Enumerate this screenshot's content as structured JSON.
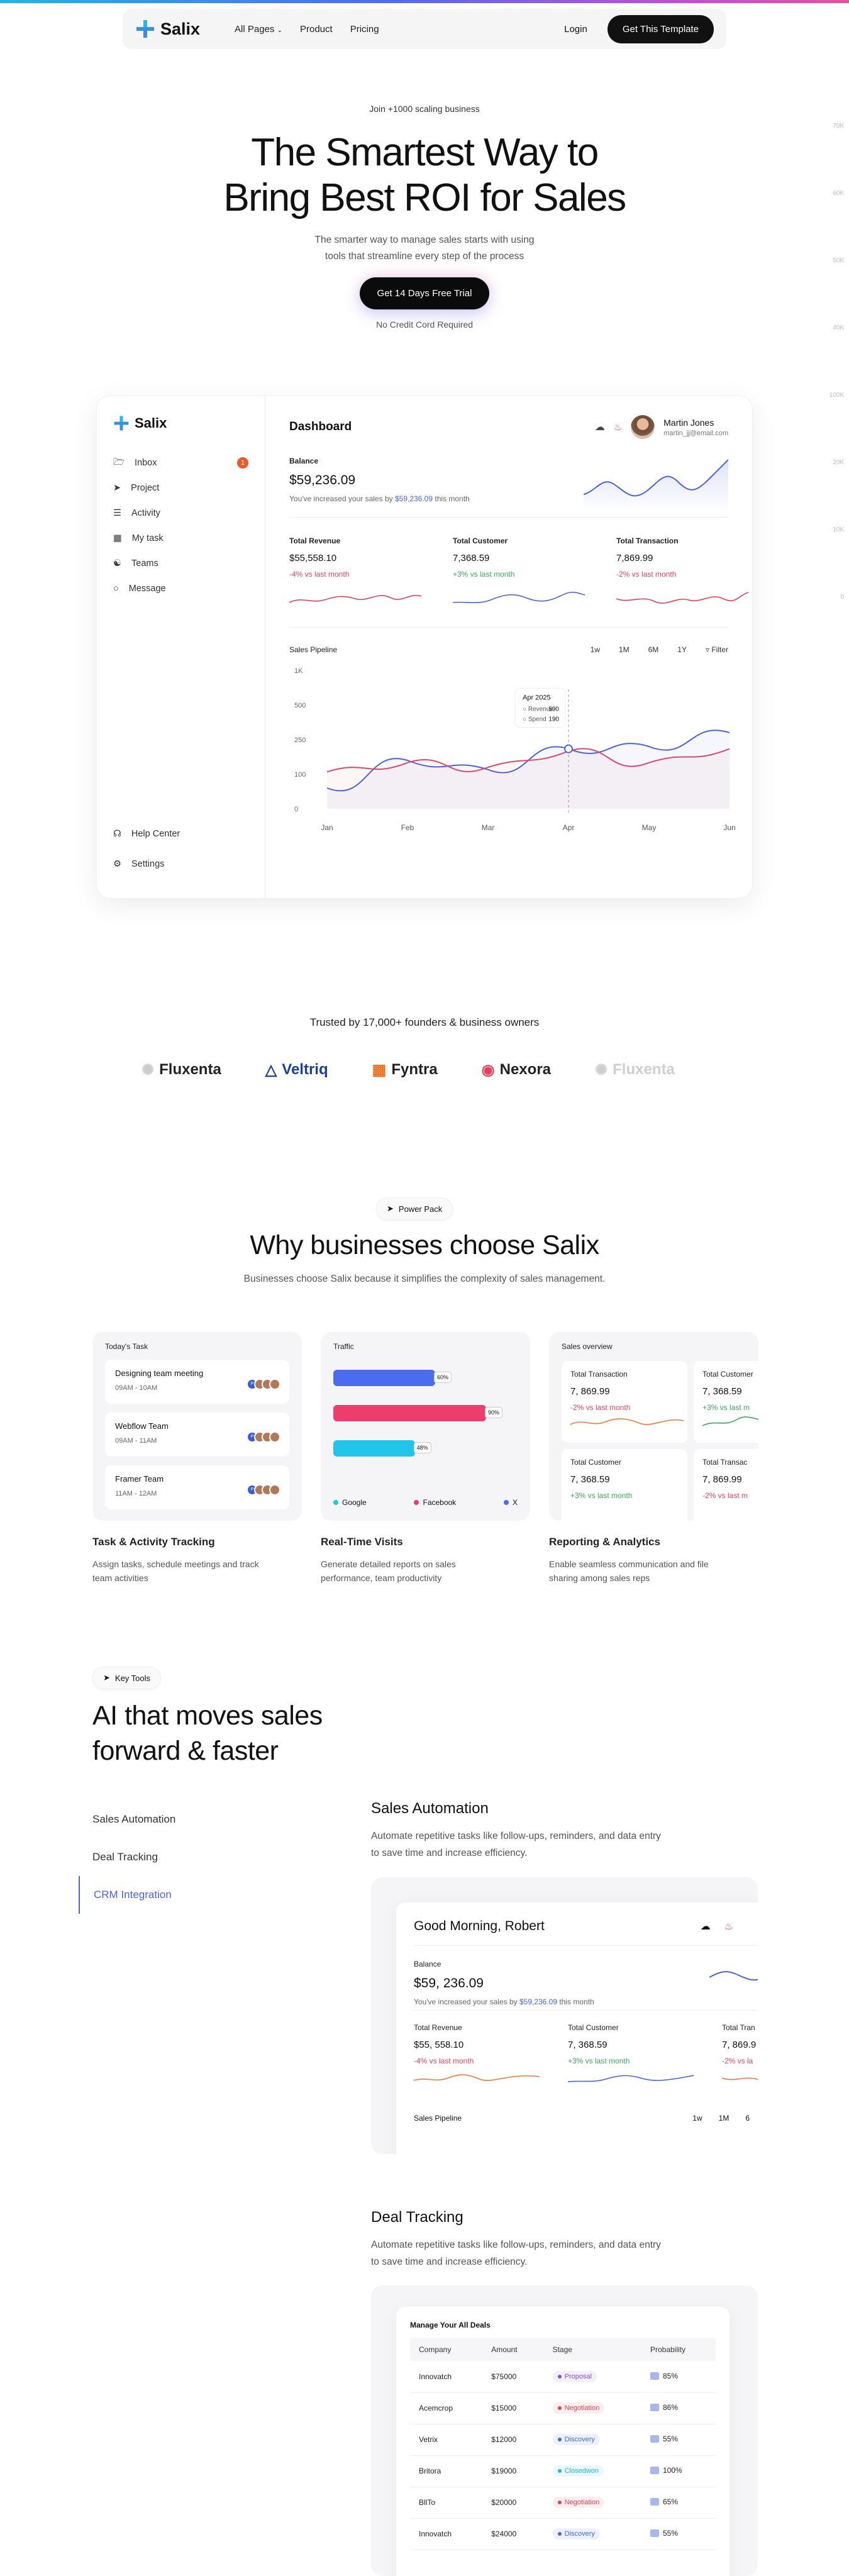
{
  "brand": {
    "name": "Salix",
    "accent": "#4b63e0",
    "logo_colors": [
      "#1fb4e8",
      "#4f6cf0"
    ]
  },
  "nav": {
    "links": [
      "All Pages",
      "Product",
      "Pricing"
    ],
    "login": "Login",
    "cta": "Get This Template"
  },
  "guide_ticks": [
    "70K",
    "60K",
    "50K",
    "40K",
    "100K",
    "20K",
    "10K",
    "0"
  ],
  "hero": {
    "kicker": "Join +1000 scaling business",
    "title_line1": "The Smartest Way to",
    "title_line2": "Bring Best ROI for Sales",
    "subtitle": "The smarter way to manage sales starts with using tools that streamline every step of the process",
    "cta": "Get 14 Days Free Trial",
    "note": "No Credit Cord Required"
  },
  "dashboard": {
    "menu": [
      {
        "label": "Inbox",
        "icon": "folder-icon",
        "badge": "1"
      },
      {
        "label": "Project",
        "icon": "rocket-icon"
      },
      {
        "label": "Activity",
        "icon": "activity-icon"
      },
      {
        "label": "My task",
        "icon": "task-icon"
      },
      {
        "label": "Teams",
        "icon": "teams-icon"
      },
      {
        "label": "Message",
        "icon": "message-icon"
      }
    ],
    "bottom_menu": [
      {
        "label": "Help Center",
        "icon": "headset-icon"
      },
      {
        "label": "Settings",
        "icon": "gear-icon"
      }
    ],
    "title": "Dashboard",
    "user": {
      "name": "Martin Jones",
      "email": "martin_jj@email.com"
    },
    "balance": {
      "label": "Balance",
      "value": "$59,236.09",
      "note_prefix": "You've increased your sales by",
      "note_value": "$59,236.09",
      "note_suffix": "this month"
    },
    "stats": [
      {
        "label": "Total Revenue",
        "value": "$55,558.10",
        "change": "-4% vs last month",
        "trend": "down"
      },
      {
        "label": "Total Customer",
        "value": "7,368.59",
        "change": "+3% vs last month",
        "trend": "up"
      },
      {
        "label": "Total Transaction",
        "value": "7,869.99",
        "change": "-2% vs last month",
        "trend": "down"
      }
    ],
    "pipeline": {
      "title": "Sales Pipeline",
      "ranges": [
        "1w",
        "1M",
        "6M",
        "1Y"
      ],
      "filter": "Filter"
    }
  },
  "chart_data": {
    "type": "line",
    "title": "Sales Pipeline",
    "categories": [
      "Jan",
      "Feb",
      "Mar",
      "Apr",
      "May",
      "Jun"
    ],
    "y_ticks": [
      "0",
      "100",
      "250",
      "500",
      "1K"
    ],
    "ylim": [
      0,
      1000
    ],
    "series": [
      {
        "name": "Revenue",
        "color": "#4b63e0",
        "values": [
          60,
          160,
          120,
          210,
          220,
          300
        ]
      },
      {
        "name": "Spend",
        "color": "#d94b6b",
        "values": [
          110,
          150,
          130,
          200,
          150,
          210
        ]
      }
    ],
    "tooltip": {
      "title": "Apr 2025",
      "rows": [
        {
          "name": "Revenue",
          "value": "590"
        },
        {
          "name": "Spend",
          "value": "190"
        }
      ]
    },
    "grid": false
  },
  "trusted": {
    "text": "Trusted by 17,000+ founders & business owners",
    "logos": [
      {
        "name": "Fluxenta",
        "color": "#222",
        "icon": "flux-icon"
      },
      {
        "name": "Veltriq",
        "color": "#1d3f9a",
        "icon": "veltriq-icon"
      },
      {
        "name": "Fyntra",
        "color": "#222",
        "icon": "fyntra-icon"
      },
      {
        "name": "Nexora",
        "color": "#222",
        "icon": "nexora-icon"
      },
      {
        "name": "Fluxenta",
        "color": "#c8c8c8",
        "icon": "flux-icon"
      }
    ]
  },
  "why": {
    "pill": "Power Pack",
    "title": "Why businesses choose Salix",
    "subtitle": "Businesses choose Salix because it simplifies the complexity of sales management.",
    "tasks": {
      "title": "Today's Task",
      "items": [
        {
          "name": "Designing team meeting",
          "time": "09AM - 10AM"
        },
        {
          "name": "Webflow Team",
          "time": "09AM - 11AM"
        },
        {
          "name": "Framer Team",
          "time": "11AM - 12AM"
        }
      ]
    },
    "traffic": {
      "title": "Traffic",
      "bars": [
        {
          "name": "Google",
          "value": 0.6,
          "label": "60%",
          "color": "#4b6cf0"
        },
        {
          "name": "Facebook",
          "value": 0.9,
          "label": "90%",
          "color": "#ee3d6c"
        },
        {
          "name": "X",
          "value": 0.48,
          "label": "48%",
          "color": "#22c5e8"
        }
      ]
    },
    "overview": {
      "title": "Sales overview",
      "cards": [
        {
          "label": "Total Transaction",
          "value": "7, 869.99",
          "change": "-2% vs last month",
          "trend": "down"
        },
        {
          "label": "Total Customer",
          "value": "7, 368.59",
          "change": "+3% vs last m",
          "trend": "up"
        },
        {
          "label": "Total Customer",
          "value": "7, 368.59",
          "change": "+3% vs last month",
          "trend": "up"
        },
        {
          "label": "Total Transac",
          "value": "7, 869.99",
          "change": "-2% vs last m",
          "trend": "down"
        }
      ]
    },
    "captions": [
      {
        "title": "Task & Activity Tracking",
        "text": "Assign tasks, schedule meetings and track team activities"
      },
      {
        "title": "Real-Time Visits",
        "text": "Generate detailed reports on sales performance, team productivity"
      },
      {
        "title": "Reporting & Analytics",
        "text": "Enable seamless communication and file sharing among sales reps"
      }
    ]
  },
  "ai": {
    "pill": "Key Tools",
    "title_line1": "AI that moves sales",
    "title_line2": "forward & faster",
    "tabs": [
      "Sales Automation",
      "Deal Tracking",
      "CRM Integration"
    ],
    "active_tab": 2,
    "automation": {
      "title": "Sales Automation",
      "text": "Automate repetitive tasks like follow-ups, reminders, and data entry to save time and increase efficiency.",
      "greeting": "Good Morning, Robert",
      "balance": {
        "label": "Balance",
        "value": "$59, 236.09",
        "note_prefix": "You've increased your sales by",
        "note_value": "$59,236.09",
        "note_suffix": "this month"
      },
      "stats": [
        {
          "label": "Total Revenue",
          "value": "$55, 558.10",
          "change": "-4% vs last month",
          "trend": "down"
        },
        {
          "label": "Total Customer",
          "value": "7, 368.59",
          "change": "+3% vs last month",
          "trend": "up"
        },
        {
          "label": "Total Tran",
          "value": "7, 869.9",
          "change": "-2% vs la",
          "trend": "down"
        }
      ],
      "pipeline": "Sales Pipeline",
      "ranges": [
        "1w",
        "1M",
        "6"
      ]
    },
    "deals": {
      "title": "Deal Tracking",
      "text": "Automate repetitive tasks like follow-ups, reminders, and data entry to save time and increase efficiency.",
      "table_title": "Manage Your All Deals",
      "columns": [
        "Company",
        "Amount",
        "Stage",
        "Probability"
      ],
      "rows": [
        [
          "Innovatch",
          "$75000",
          "Proposal",
          "85%"
        ],
        [
          "Acemcrop",
          "$15000",
          "Negotiation",
          "86%"
        ],
        [
          "Vetrix",
          "$12000",
          "Discovery",
          "55%"
        ],
        [
          "Britora",
          "$19000",
          "Closedwon",
          "100%"
        ],
        [
          "BllTo",
          "$20000",
          "Negotiation",
          "65%"
        ],
        [
          "Innovatch",
          "$24000",
          "Discovery",
          "55%"
        ]
      ],
      "stage_colors": {
        "Proposal": "#7b52d9",
        "Negotiation": "#e2425a",
        "Discovery": "#3f6ae0",
        "Closedwon": "#22b5d8"
      }
    }
  }
}
